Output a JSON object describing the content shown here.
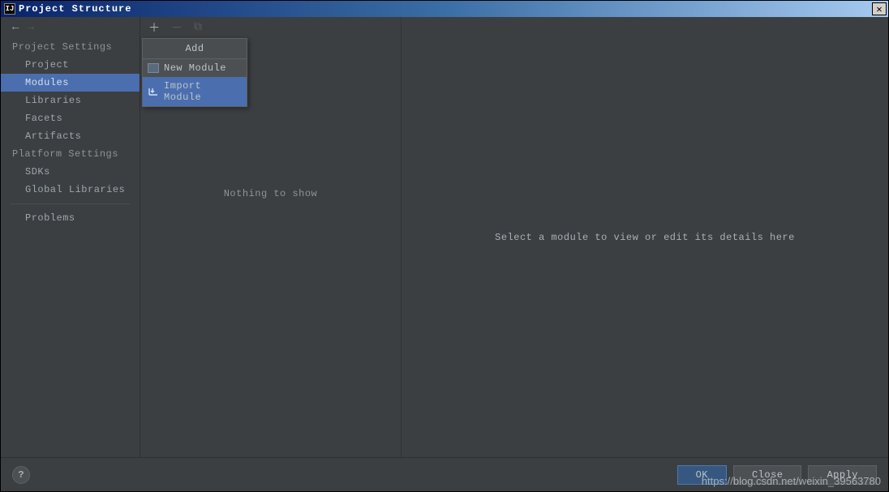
{
  "window": {
    "title": "Project Structure"
  },
  "sidebar": {
    "sections": [
      {
        "label": "Project Settings",
        "items": [
          {
            "label": "Project"
          },
          {
            "label": "Modules",
            "selected": true
          },
          {
            "label": "Libraries"
          },
          {
            "label": "Facets"
          },
          {
            "label": "Artifacts"
          }
        ]
      },
      {
        "label": "Platform Settings",
        "items": [
          {
            "label": "SDKs"
          },
          {
            "label": "Global Libraries"
          }
        ]
      }
    ],
    "extra": {
      "label": "Problems"
    }
  },
  "mid": {
    "popup": {
      "title": "Add",
      "items": [
        {
          "label": "New Module",
          "icon": "folder",
          "selected": false
        },
        {
          "label": "Import Module",
          "icon": "import",
          "selected": true
        }
      ]
    },
    "empty": "Nothing to show"
  },
  "right": {
    "empty": "Select a module to view or edit its details here"
  },
  "footer": {
    "ok": "OK",
    "cancel": "Close",
    "apply": "Apply"
  },
  "watermark": "https://blog.csdn.net/weixin_39563780"
}
